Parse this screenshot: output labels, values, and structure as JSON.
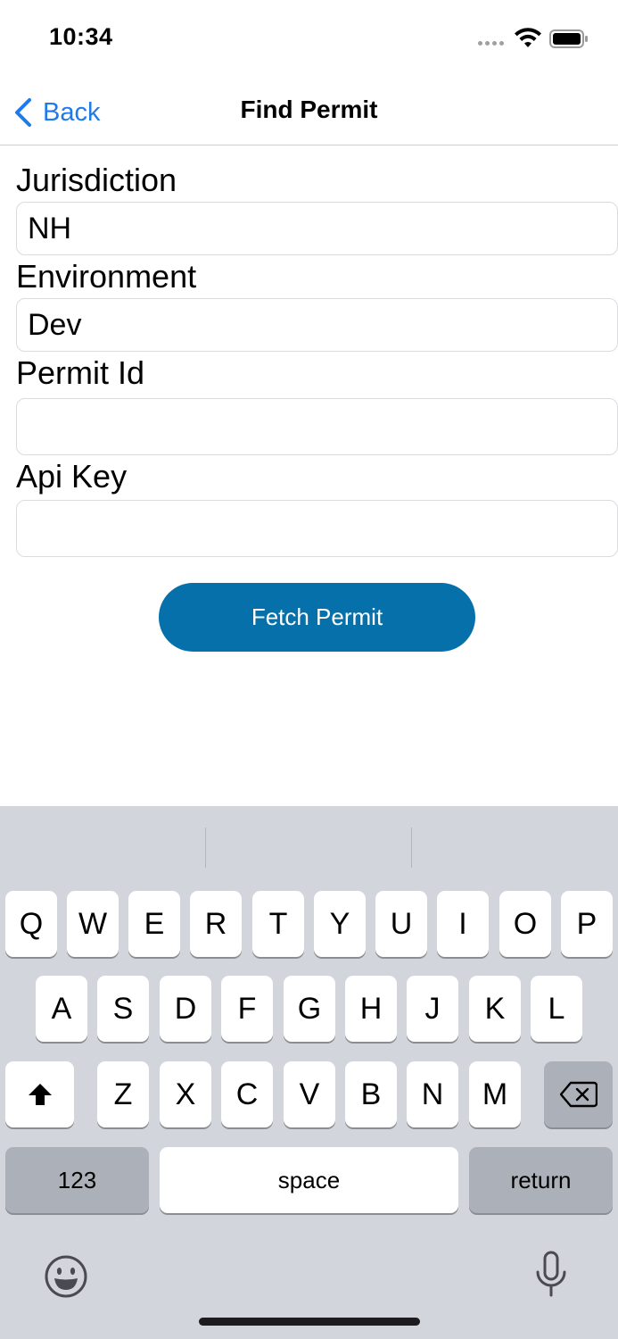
{
  "status_bar": {
    "time": "10:34"
  },
  "nav": {
    "back_label": "Back",
    "title": "Find Permit"
  },
  "form": {
    "fields": [
      {
        "label": "Jurisdiction",
        "value": "NH"
      },
      {
        "label": "Environment",
        "value": "Dev"
      },
      {
        "label": "Permit Id",
        "value": ""
      },
      {
        "label": "Api Key",
        "value": ""
      }
    ],
    "fetch_label": "Fetch Permit"
  },
  "keyboard": {
    "row1": [
      "Q",
      "W",
      "E",
      "R",
      "T",
      "Y",
      "U",
      "I",
      "O",
      "P"
    ],
    "row2": [
      "A",
      "S",
      "D",
      "F",
      "G",
      "H",
      "J",
      "K",
      "L"
    ],
    "row3": [
      "Z",
      "X",
      "C",
      "V",
      "B",
      "N",
      "M"
    ],
    "numbers_label": "123",
    "space_label": "space",
    "return_label": "return",
    "icons": [
      "shift-icon",
      "backspace-icon",
      "emoji-icon",
      "microphone-icon"
    ]
  },
  "colors": {
    "accent": "#1f7aea",
    "button": "#0670ab",
    "keyboard_bg": "#d3d5dc"
  }
}
